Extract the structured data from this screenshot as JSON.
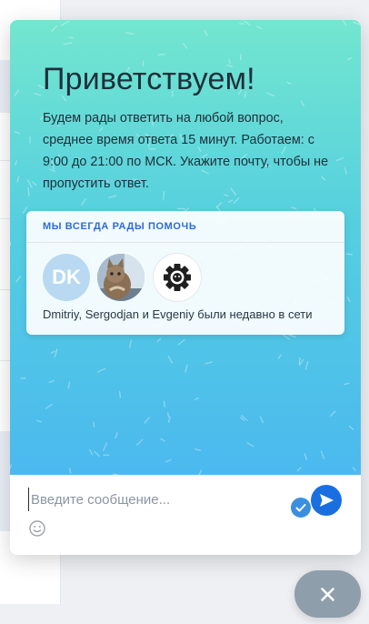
{
  "widget": {
    "greeting": "Приветствуем!",
    "intro": "Будем рады ответить на любой вопрос, среднее время ответа 15 минут. Работаем: с 9:00 до 21:00 по МСК. Укажите почту, чтобы не пропустить ответ.",
    "team_card": {
      "heading": "МЫ ВСЕГДА РАДЫ ПОМОЧЬ",
      "avatars": [
        {
          "initials": "DK",
          "color": "#b8d9f1"
        },
        {
          "type": "photo"
        },
        {
          "type": "gear-logo"
        }
      ],
      "status": "Dmitriy, Sergodjan и Evgeniy были недавно в сети"
    },
    "composer": {
      "placeholder": "Введите сообщение...",
      "value": ""
    }
  },
  "colors": {
    "gradient_top": "#73e6cf",
    "gradient_bottom": "#4bb9ef",
    "accent": "#1a6fe0",
    "heading_blue": "#2d6bd6"
  },
  "icons": [
    "check-icon",
    "send-icon",
    "emoji-icon",
    "close-icon",
    "gear-icon"
  ]
}
